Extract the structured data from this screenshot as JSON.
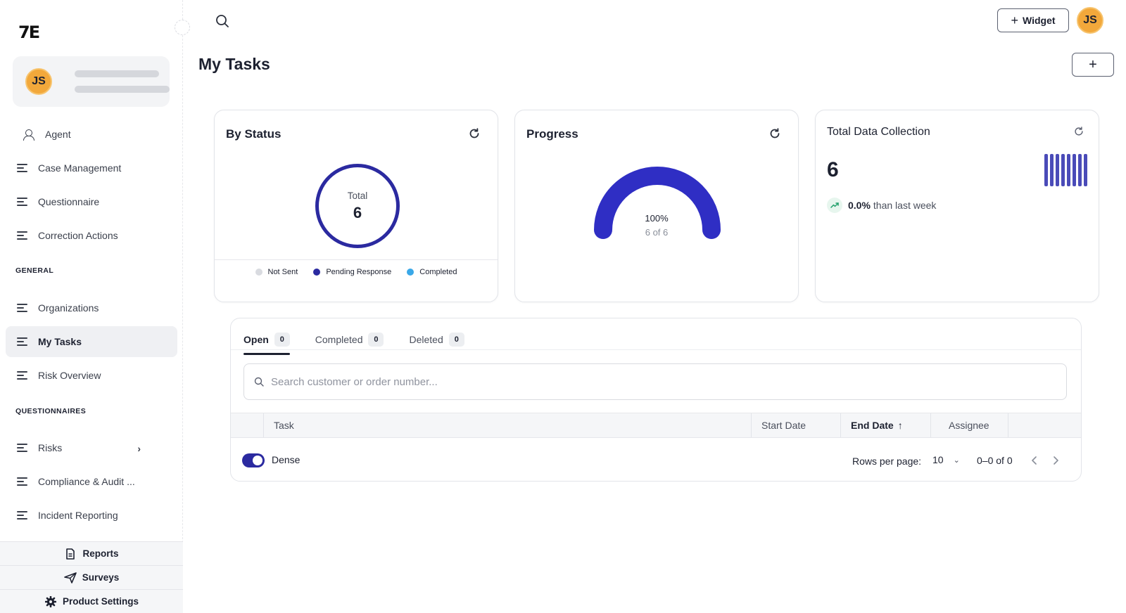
{
  "brand": {
    "logo": "7E"
  },
  "user": {
    "initials": "JS"
  },
  "sidebar": {
    "items_top": [
      {
        "label": "Agent"
      },
      {
        "label": "Case Management"
      },
      {
        "label": "Questionnaire"
      },
      {
        "label": "Correction Actions"
      }
    ],
    "section_general": "GENERAL",
    "items_general": [
      {
        "label": "Organizations"
      },
      {
        "label": "My Tasks"
      },
      {
        "label": "Risk Overview"
      }
    ],
    "section_questionnaires": "QUESTIONNAIRES",
    "items_questionnaires": [
      {
        "label": "Risks"
      },
      {
        "label": "Compliance & Audit ..."
      },
      {
        "label": "Incident Reporting"
      }
    ],
    "bottom": {
      "reports": "Reports",
      "surveys": "Surveys",
      "product_settings": "Product Settings"
    }
  },
  "topbar": {
    "widget_label": "Widget"
  },
  "page": {
    "title": "My Tasks",
    "add_label": "+"
  },
  "cards": {
    "by_status": {
      "title": "By Status",
      "total_label": "Total",
      "total_value": "6",
      "legend": [
        {
          "label": "Not Sent",
          "color": "#d9dbe0"
        },
        {
          "label": "Pending Response",
          "color": "#2b2aa0"
        },
        {
          "label": "Completed",
          "color": "#3aa8e8"
        }
      ]
    },
    "progress": {
      "title": "Progress",
      "percent_text": "100%",
      "sub_text": "6 of 6",
      "fraction": 1.0,
      "color": "#2f2ec4"
    },
    "total_data_collection": {
      "title": "Total Data Collection",
      "value": "6",
      "trend_pct": "0.0%",
      "trend_text": "than last week",
      "trend_color": "#22a06b"
    }
  },
  "tasks": {
    "tabs": [
      {
        "label": "Open",
        "count": "0"
      },
      {
        "label": "Completed",
        "count": "0"
      },
      {
        "label": "Deleted",
        "count": "0"
      }
    ],
    "search_placeholder": "Search customer or order number...",
    "columns": {
      "task": "Task",
      "start_date": "Start Date",
      "end_date": "End Date",
      "assignee": "Assignee"
    },
    "dense_label": "Dense",
    "rows_per_page_label": "Rows per page:",
    "rows_per_page_value": "10",
    "range_text": "0–0 of 0"
  },
  "colors": {
    "accent": "#2b2aa0",
    "avatar": "#f2a83b"
  }
}
